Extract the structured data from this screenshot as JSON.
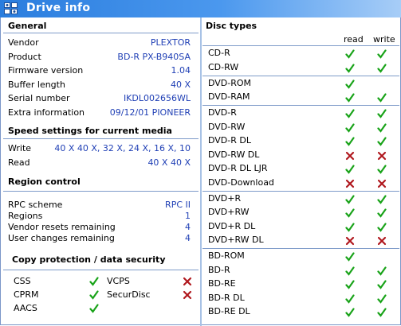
{
  "window": {
    "title": "Drive info",
    "icon": "drive-info-app-icon"
  },
  "general": {
    "title": "General",
    "rows": [
      {
        "label": "Vendor",
        "value": "PLEXTOR"
      },
      {
        "label": "Product",
        "value": "BD-R   PX-B940SA"
      },
      {
        "label": "Firmware version",
        "value": "1.04"
      },
      {
        "label": "Buffer length",
        "value": "40 X"
      },
      {
        "label": "Serial number",
        "value": "IKDL002656WL"
      },
      {
        "label": "Extra information",
        "value": "09/12/01  PIONEER"
      }
    ]
  },
  "speed": {
    "title": "Speed settings for current media",
    "rows": [
      {
        "label": "Write",
        "value": "40 X 40 X, 32 X, 24 X, 16 X, 10"
      },
      {
        "label": "Read",
        "value": "40 X 40 X"
      }
    ]
  },
  "region": {
    "title": "Region control",
    "rows": [
      {
        "label": "RPC scheme",
        "value": "RPC II"
      },
      {
        "label": "Regions",
        "value": "1"
      },
      {
        "label": "Vendor resets remaining",
        "value": "4"
      },
      {
        "label": "User changes remaining",
        "value": "4"
      }
    ]
  },
  "copy_protection": {
    "title": "Copy protection / data security",
    "items": [
      {
        "label": "CSS",
        "supported": true
      },
      {
        "label": "VCPS",
        "supported": false
      },
      {
        "label": "CPRM",
        "supported": true
      },
      {
        "label": "SecurDisc",
        "supported": false
      },
      {
        "label": "AACS",
        "supported": true
      }
    ]
  },
  "disc_types": {
    "title": "Disc types",
    "read_header": "read",
    "write_header": "write",
    "groups": [
      [
        {
          "name": "CD-R",
          "read": true,
          "write": true
        },
        {
          "name": "CD-RW",
          "read": true,
          "write": true
        }
      ],
      [
        {
          "name": "DVD-ROM",
          "read": true,
          "write": null
        },
        {
          "name": "DVD-RAM",
          "read": true,
          "write": true
        }
      ],
      [
        {
          "name": "DVD-R",
          "read": true,
          "write": true
        },
        {
          "name": "DVD-RW",
          "read": true,
          "write": true
        },
        {
          "name": "DVD-R DL",
          "read": true,
          "write": true
        },
        {
          "name": "DVD-RW DL",
          "read": false,
          "write": false
        },
        {
          "name": "DVD-R DL LJR",
          "read": true,
          "write": true
        },
        {
          "name": "DVD-Download",
          "read": false,
          "write": false
        }
      ],
      [
        {
          "name": "DVD+R",
          "read": true,
          "write": true
        },
        {
          "name": "DVD+RW",
          "read": true,
          "write": true
        },
        {
          "name": "DVD+R DL",
          "read": true,
          "write": true
        },
        {
          "name": "DVD+RW DL",
          "read": false,
          "write": false
        }
      ],
      [
        {
          "name": "BD-ROM",
          "read": true,
          "write": null
        },
        {
          "name": "BD-R",
          "read": true,
          "write": true
        },
        {
          "name": "BD-RE",
          "read": true,
          "write": true
        },
        {
          "name": "BD-R DL",
          "read": true,
          "write": true
        },
        {
          "name": "BD-RE DL",
          "read": true,
          "write": true
        }
      ]
    ]
  },
  "colors": {
    "check": "#19a319",
    "cross": "#b0181e",
    "value_text": "#1f3fb5",
    "title_bar": "#2a7dde",
    "section_line": "#7e9bc9"
  },
  "icons": {
    "supported": "check-icon",
    "unsupported": "cross-icon"
  }
}
